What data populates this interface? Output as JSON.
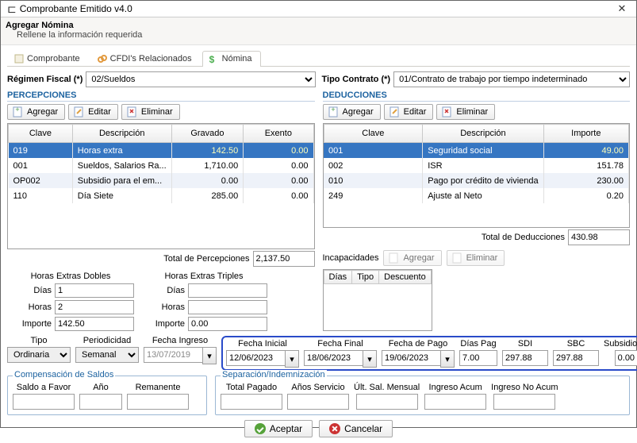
{
  "window": {
    "title": "Comprobante Emitido v4.0"
  },
  "subheader": {
    "title": "Agregar Nómina",
    "subtitle": "Rellene la información requerida"
  },
  "tabs": {
    "comprobante": "Comprobante",
    "cfdis": "CFDI's Relacionados",
    "nomina": "Nómina"
  },
  "top": {
    "regimen_label": "Régimen Fiscal (*)",
    "regimen_value": "02/Sueldos",
    "tipo_label": "Tipo Contrato (*)",
    "tipo_value": "01/Contrato de trabajo por tiempo indeterminado"
  },
  "buttons": {
    "agregar": "Agregar",
    "editar": "Editar",
    "eliminar": "Eliminar"
  },
  "percepciones": {
    "title": "PERCEPCIONES",
    "headers": {
      "clave": "Clave",
      "desc": "Descripción",
      "grav": "Gravado",
      "exen": "Exento"
    },
    "rows": [
      {
        "clave": "019",
        "desc": "Horas extra",
        "grav": "142.50",
        "exen": "0.00"
      },
      {
        "clave": "001",
        "desc": "Sueldos, Salarios  Ra...",
        "grav": "1,710.00",
        "exen": "0.00"
      },
      {
        "clave": "OP002",
        "desc": "Subsidio para el em...",
        "grav": "0.00",
        "exen": "0.00"
      },
      {
        "clave": "110",
        "desc": "Día Siete",
        "grav": "285.00",
        "exen": "0.00"
      }
    ],
    "total_label": "Total de Percepciones",
    "total_value": "2,137.50"
  },
  "deducciones": {
    "title": "DEDUCCIONES",
    "headers": {
      "clave": "Clave",
      "desc": "Descripción",
      "imp": "Importe"
    },
    "rows": [
      {
        "clave": "001",
        "desc": "Seguridad social",
        "imp": "49.00"
      },
      {
        "clave": "002",
        "desc": "ISR",
        "imp": "151.78"
      },
      {
        "clave": "010",
        "desc": "Pago por crédito de vivienda",
        "imp": "230.00"
      },
      {
        "clave": "249",
        "desc": "Ajuste al Neto",
        "imp": "0.20"
      }
    ],
    "total_label": "Total de Deducciones",
    "total_value": "430.98"
  },
  "horas": {
    "dobles_label": "Horas Extras Dobles",
    "triples_label": "Horas Extras Triples",
    "dias_label": "Días",
    "horas_label": "Horas",
    "importe_label": "Importe",
    "d_dias": "1",
    "d_horas": "2",
    "d_importe": "142.50",
    "t_dias": "",
    "t_horas": "",
    "t_importe": "0.00"
  },
  "incap": {
    "title": "Incapacidades",
    "headers": {
      "dias": "Días",
      "tipo": "Tipo",
      "descuento": "Descuento"
    }
  },
  "fechas": {
    "tipo_label": "Tipo",
    "tipo_value": "Ordinaria",
    "period_label": "Periodicidad",
    "period_value": "Semanal",
    "fingreso_label": "Fecha Ingreso",
    "fingreso_value": "13/07/2019",
    "finicial_label": "Fecha Inicial",
    "finicial_value": "12/06/2023",
    "ffinal_label": "Fecha Final",
    "ffinal_value": "18/06/2023",
    "fpago_label": "Fecha de Pago",
    "fpago_value": "19/06/2023",
    "diaspag_label": "Días Pag",
    "diaspag_value": "7.00",
    "sdi_label": "SDI",
    "sdi_value": "297.88",
    "sbc_label": "SBC",
    "sbc_value": "297.88",
    "subsidio_label": "Subsidio Causado",
    "subsidio_value": "0.00"
  },
  "comp": {
    "title": "Compensación de Saldos",
    "saldo_label": "Saldo a Favor",
    "ano_label": "Año",
    "rem_label": "Remanente",
    "saldo": "",
    "ano": "",
    "rem": ""
  },
  "sep": {
    "title": "Separación/Indemnización",
    "tp_label": "Total Pagado",
    "as_label": "Años Servicio",
    "usm_label": "Últ. Sal. Mensual",
    "ia_label": "Ingreso Acum",
    "ina_label": "Ingreso No Acum"
  },
  "footer": {
    "aceptar": "Aceptar",
    "cancelar": "Cancelar"
  }
}
